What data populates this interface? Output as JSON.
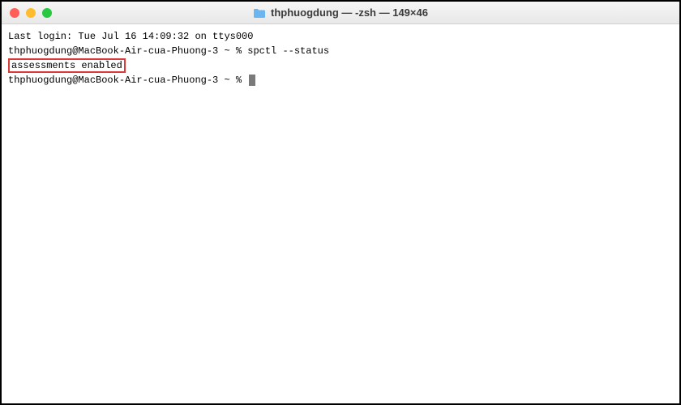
{
  "window": {
    "title": "thphuogdung — -zsh — 149×46",
    "icon": "folder-icon"
  },
  "terminal": {
    "last_login": "Last login: Tue Jul 16 14:09:32 on ttys000",
    "prompt1_user_host": "thphuogdung@MacBook-Air-cua-Phuong-3 ~ % ",
    "command1": "spctl --status",
    "output1": "assessments enabled",
    "prompt2_user_host": "thphuogdung@MacBook-Air-cua-Phuong-3 ~ % "
  }
}
